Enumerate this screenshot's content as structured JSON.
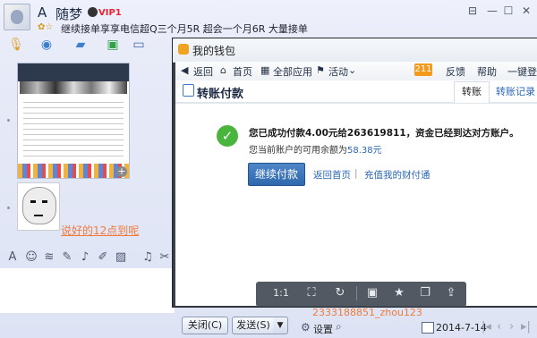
{
  "chat": {
    "contact_initial": "A",
    "contact_name": "随梦",
    "vip_label": "VIP1",
    "signature": "继续接单享享电信超Q三个月5R 超会一个月6R 大量接单",
    "message_link": "说好的12点到呢",
    "close_label": "关闭(C)",
    "send_label": "发送(S)",
    "qq_numbers": "2333188851_zhou123",
    "settings_label": "设置",
    "date": "2014-7-14"
  },
  "wallet": {
    "title": "我的钱包",
    "nav": {
      "back": "返回",
      "home": "首页",
      "all_apps": "全部应用",
      "activity": "活动",
      "badge": "211",
      "feedback": "反馈",
      "help": "帮助",
      "login": "一键登录"
    },
    "page_title": "转账付款",
    "tabs": {
      "transfer": "转账",
      "records": "转账记录"
    },
    "success_message": "您已成功付款4.00元给263619811，资金已经到达对方账户。",
    "balance_prefix": "您当前账户的可用余额为",
    "balance_amount": "58.38元",
    "continue_button": "继续付款",
    "home_link": "返回首页",
    "separator": "|",
    "recharge_link": "充值我的财付通"
  },
  "screenshot_toolbar": {
    "icons": [
      "ratio-icon",
      "crop-icon",
      "rotate-icon",
      "save-icon",
      "pin-icon",
      "copy-icon",
      "share-icon"
    ],
    "ratio_label": "1:1"
  },
  "colors": {
    "link_orange": "#f07b3b",
    "link_blue": "#2a66b4",
    "success_green": "#49b53c",
    "button_blue": "#2f68ad",
    "badge_orange": "#f39a1d"
  }
}
